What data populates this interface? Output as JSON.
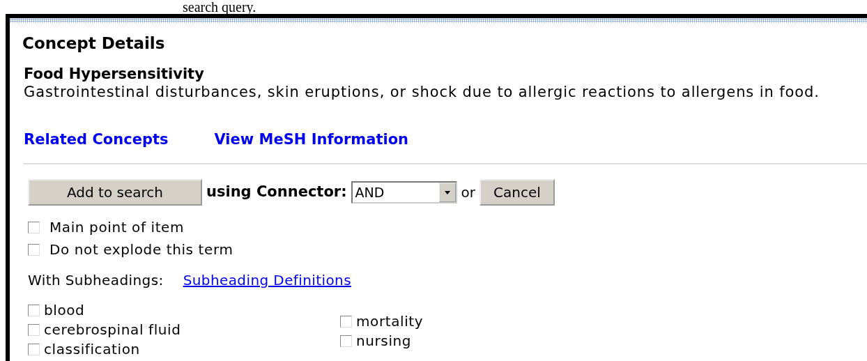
{
  "above_frame_text": "search query.",
  "panel": {
    "title": "Concept Details",
    "concept": {
      "name": "Food Hypersensitivity",
      "definition": "Gastrointestinal disturbances, skin eruptions, or shock due to allergic reactions to allergens in food."
    },
    "links": [
      "Related Concepts",
      "View MeSH Information"
    ],
    "actions": {
      "add_button": "Add to search",
      "connector_label": "using Connector:",
      "connector_value": "AND",
      "or_text": "or",
      "cancel_button": "Cancel"
    },
    "options": [
      {
        "label": "Main point of item",
        "checked": false
      },
      {
        "label": "Do not explode this term",
        "checked": false
      }
    ],
    "subheadings_label": "With Subheadings:",
    "subheadings_link": "Subheading Definitions",
    "subheading_columns": [
      [
        {
          "label": "blood",
          "checked": false
        },
        {
          "label": "cerebrospinal fluid",
          "checked": false
        },
        {
          "label": "classification",
          "checked": false
        }
      ],
      [
        {
          "label": "mortality",
          "checked": false
        },
        {
          "label": "nursing",
          "checked": false
        }
      ]
    ]
  }
}
